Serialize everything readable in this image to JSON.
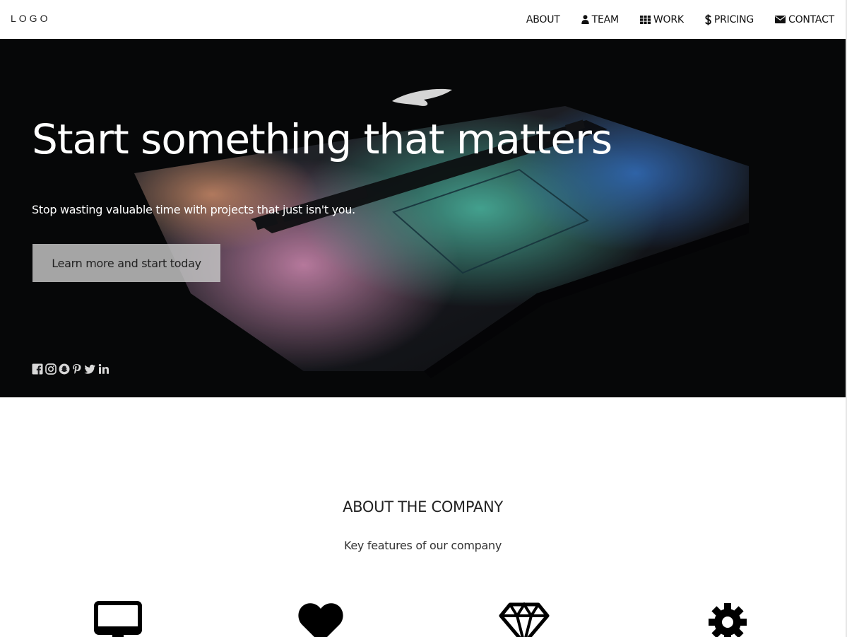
{
  "header": {
    "logo": "LOGO",
    "nav": [
      {
        "label": "ABOUT",
        "icon": ""
      },
      {
        "label": "TEAM",
        "icon": "user-icon"
      },
      {
        "label": "WORK",
        "icon": "grid-icon"
      },
      {
        "label": "PRICING",
        "icon": "dollar-icon"
      },
      {
        "label": "CONTACT",
        "icon": "envelope-icon"
      }
    ]
  },
  "hero": {
    "title": "Start something that matters",
    "subtitle": "Stop wasting valuable time with projects that just isn't you.",
    "cta_label": "Learn more and start today",
    "social_icons": [
      "facebook-icon",
      "instagram-icon",
      "snapchat-icon",
      "pinterest-icon",
      "twitter-icon",
      "linkedin-icon"
    ]
  },
  "about": {
    "title": "ABOUT THE COMPANY",
    "subtitle": "Key features of our company",
    "feature_icons": [
      "desktop-icon",
      "heart-icon",
      "diamond-icon",
      "gear-icon"
    ]
  },
  "colors": {
    "hero_background": "#07080a",
    "button_background": "#c8c8c8",
    "text_dark": "#222222"
  }
}
